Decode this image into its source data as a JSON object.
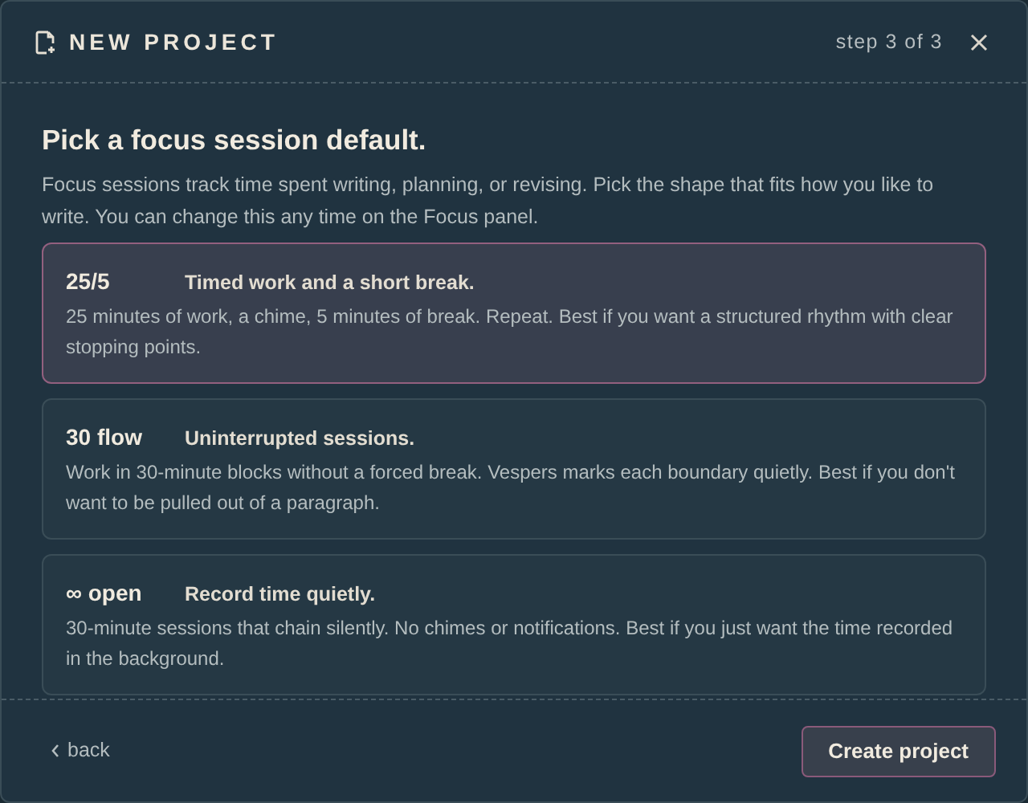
{
  "dialog": {
    "title": "NEW PROJECT",
    "step": "step 3 of 3"
  },
  "heading": "Pick a focus session default.",
  "intro": "Focus sessions track time spent writing, planning, or revising. Pick the shape that fits how you like to write. You can change this any time on the Focus panel.",
  "options": [
    {
      "name": "25/5",
      "tagline": "Timed work and a short break.",
      "description": "25 minutes of work, a chime, 5 minutes of break. Repeat. Best if you want a structured rhythm with clear stopping points.",
      "selected": true
    },
    {
      "name": "30 flow",
      "tagline": "Uninterrupted sessions.",
      "description": "Work in 30-minute blocks without a forced break. Vespers marks each boundary quietly. Best if you don't want to be pulled out of a paragraph.",
      "selected": false
    },
    {
      "name": "∞ open",
      "tagline": "Record time quietly.",
      "description": "30-minute sessions that chain silently. No chimes or notifications. Best if you just want the time recorded in the background.",
      "selected": false
    }
  ],
  "footer": {
    "back": "back",
    "primary": "Create project"
  }
}
